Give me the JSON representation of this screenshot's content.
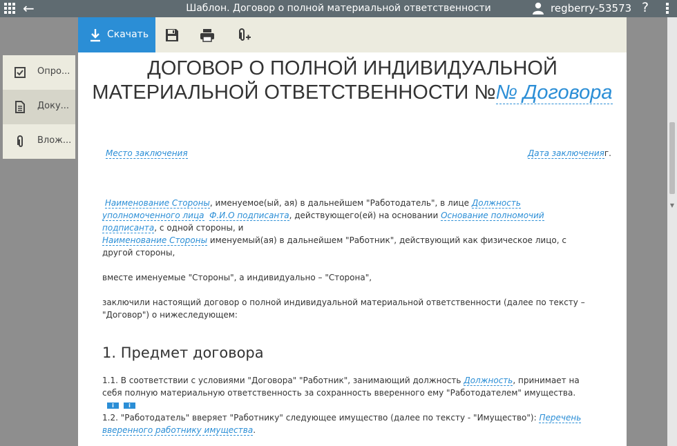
{
  "window": {
    "title": "Шаблон. Договор о полной материальной ответственности",
    "user_name": "regberry-53573",
    "help_label": "?"
  },
  "sidebar": {
    "items": [
      {
        "label": "Опро...",
        "icon": "checkbox-icon"
      },
      {
        "label": "Доку...",
        "icon": "document-icon"
      },
      {
        "label": "Влож...",
        "icon": "paperclip-icon"
      }
    ],
    "active_index": 1
  },
  "toolbar": {
    "download_label": "Скачать",
    "icons": [
      "save-icon",
      "print-icon",
      "add-attachment-icon"
    ]
  },
  "document": {
    "title_line1": "ДОГОВОР О ПОЛНОЙ ИНДИВИДУАЛЬНОЙ",
    "title_line2_text": "МАТЕРИАЛЬНОЙ ОТВЕТСТВЕННОСТИ №",
    "title_field": "№ Договора",
    "place_field": "Место заключения",
    "date_field": "Дата заключения",
    "date_suffix": "г.",
    "para1": {
      "field1": "Наименование Стороны",
      "text1": ", именуемое(ый, ая) в дальнейшем \"Работодатель\", в лице",
      "field2": "Должность уполномоченного лица",
      "field3": "Ф.И.О подписанта",
      "text2": ", действующего(ей) на основании",
      "field4": "Основание полномочий подписанта",
      "text3": ", с одной стороны, и"
    },
    "para2": {
      "field1": "Наименование Стороны",
      "text1": " именуемый(ая) в дальнейшем \"Работник\", действующий как физическое лицо, с другой стороны,"
    },
    "para3": "вместе именуемые \"Стороны\", а индивидуально – \"Сторона\",",
    "para4": "заключили настоящий договор о полной индивидуальной материальной ответственности (далее по тексту – \"Договор\") о нижеследующем:",
    "section1_title": "1. Предмет договора",
    "clause_1_1": {
      "text1": "1.1.  В соответствии с условиями \"Договора\" \"Работник\", занимающий должность",
      "field1": "Должность",
      "text2": ", принимает на себя полную материальную ответственность за сохранность вверенного ему \"Работодателем\" имущества.",
      "badge": "i"
    },
    "clause_1_2": {
      "text1": "1.2.  \"Работодатель\" вверяет \"Работнику\" следующее имущество (далее по тексту - \"Имущество\"):",
      "field1": "Перечень вверенного работнику имущества",
      "text2": "."
    }
  },
  "colors": {
    "topbar": "#5f6b71",
    "accent": "#2b8ed6",
    "panel": "#ecebdf",
    "background": "#8e8e8e"
  }
}
